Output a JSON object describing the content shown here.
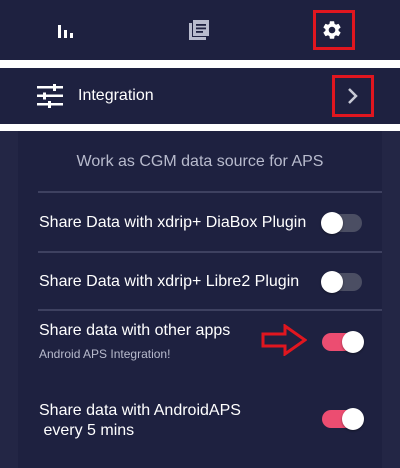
{
  "tabs": [
    {
      "id": "stats",
      "icon": "bar-chart-icon"
    },
    {
      "id": "book",
      "icon": "book-icon"
    },
    {
      "id": "settings",
      "icon": "gear-icon",
      "highlighted": true
    }
  ],
  "integration": {
    "icon": "sliders-icon",
    "label": "Integration",
    "chevron": "chevron-right-icon"
  },
  "panel": {
    "title": "Work as CGM data source for APS",
    "settings": [
      {
        "label": "Share Data with xdrip+ DiaBox Plugin",
        "enabled": false
      },
      {
        "label": "Share Data with xdrip+ Libre2 Plugin",
        "enabled": false
      },
      {
        "label": "Share data with other apps",
        "sub": "Android APS Integration!",
        "enabled": true,
        "annotated_arrow": true
      },
      {
        "label_line1": "Share data with AndroidAPS",
        "label_line2": " every 5 mins",
        "enabled": true
      }
    ]
  },
  "colors": {
    "background": "#1e2140",
    "toggle_on": "#ec4d71",
    "toggle_off": "#4b4e63",
    "annotation": "#e0161f"
  }
}
